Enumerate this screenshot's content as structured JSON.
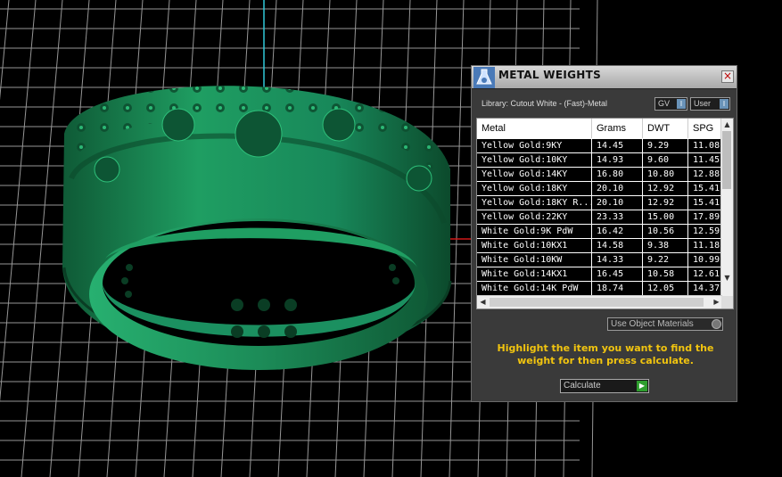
{
  "panel": {
    "title": "METAL WEIGHTS",
    "close_label": "×",
    "library_label": "Library: Cutout White - (Fast)-Metal",
    "gv_label": "GV",
    "user_label": "User",
    "object_materials_label": "Use Object Materials",
    "hint": "Highlight the item you want to find the weight for then press calculate.",
    "calculate_label": "Calculate"
  },
  "table": {
    "columns": [
      "Metal",
      "Grams",
      "DWT",
      "SPG"
    ],
    "rows": [
      {
        "metal": "Yellow Gold:9KY",
        "grams": "14.45",
        "dwt": "9.29",
        "spg": "11.08"
      },
      {
        "metal": "Yellow Gold:10KY",
        "grams": "14.93",
        "dwt": "9.60",
        "spg": "11.45"
      },
      {
        "metal": "Yellow Gold:14KY",
        "grams": "16.80",
        "dwt": "10.80",
        "spg": "12.88"
      },
      {
        "metal": "Yellow Gold:18KY",
        "grams": "20.10",
        "dwt": "12.92",
        "spg": "15.41"
      },
      {
        "metal": "Yellow Gold:18KY R...",
        "grams": "20.10",
        "dwt": "12.92",
        "spg": "15.41"
      },
      {
        "metal": "Yellow Gold:22KY",
        "grams": "23.33",
        "dwt": "15.00",
        "spg": "17.89"
      },
      {
        "metal": "White Gold:9K PdW",
        "grams": "16.42",
        "dwt": "10.56",
        "spg": "12.59"
      },
      {
        "metal": "White Gold:10KX1",
        "grams": "14.58",
        "dwt": "9.38",
        "spg": "11.18"
      },
      {
        "metal": "White Gold:10KW",
        "grams": "14.33",
        "dwt": "9.22",
        "spg": "10.99"
      },
      {
        "metal": "White Gold:14KX1",
        "grams": "16.45",
        "dwt": "10.58",
        "spg": "12.61"
      },
      {
        "metal": "White Gold:14K PdW",
        "grams": "18.74",
        "dwt": "12.05",
        "spg": "14.37"
      }
    ]
  },
  "icons": {
    "app": "gem-flask-icon",
    "close": "close-icon",
    "dropdown": "dropdown-arrow-icon",
    "go": "play-arrow-icon"
  },
  "colors": {
    "model": "#1f9e62",
    "hint_text": "#f1c40f",
    "panel_bg": "#3a3a3a",
    "grid_lines": "#c8c8c8",
    "axis_red": "#d01818",
    "axis_cyan": "#30c8d8"
  }
}
